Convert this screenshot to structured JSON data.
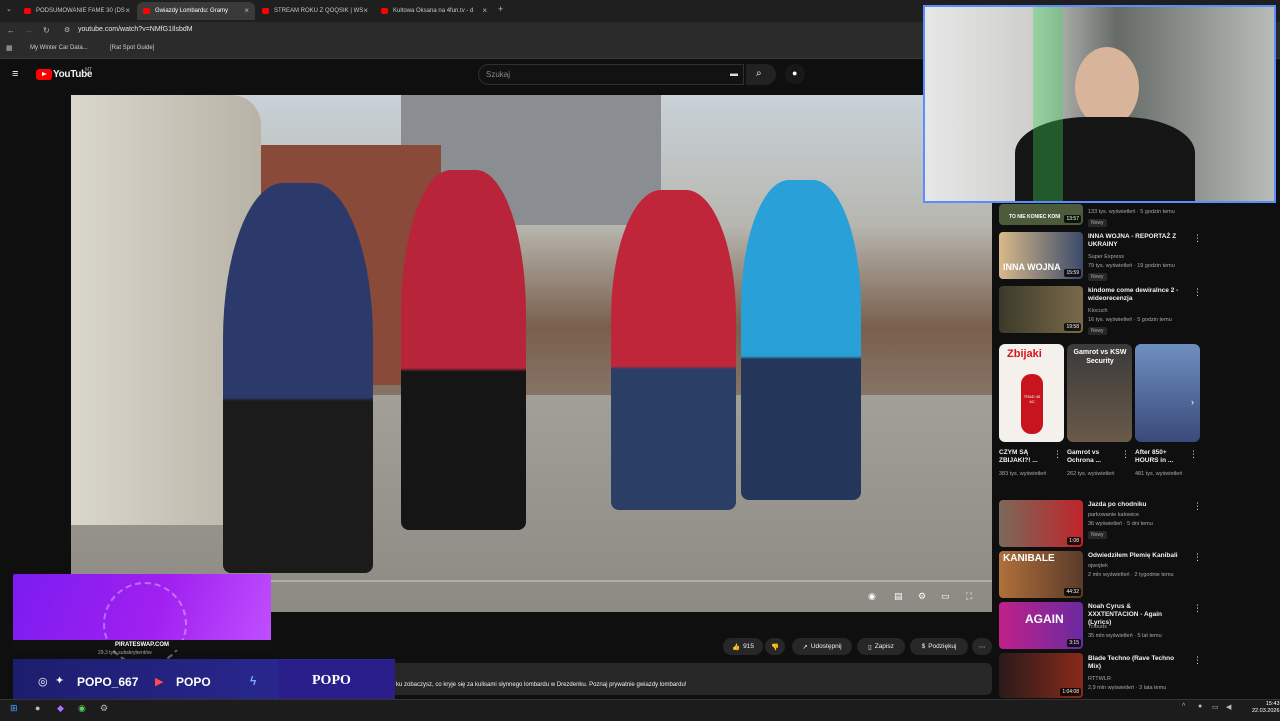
{
  "browser": {
    "tabs": [
      {
        "label": "PODSUMOWANIE FAME 30 (DS"
      },
      {
        "label": "Gwiazdy Lombardu: Gramy"
      },
      {
        "label": "STREAM ROKU Z QOQSIK | WS"
      },
      {
        "label": "Kultowa Oksana na 4fun.tv - d"
      }
    ],
    "url": "youtube.com/watch?v=NMfG1IlsbdM",
    "bookmarks": [
      "My Winter Car Data...",
      "[Rat Spot Guide]"
    ]
  },
  "youtube": {
    "logo": "YouTube",
    "country": "MT",
    "search_placeholder": "Szukaj"
  },
  "actions": {
    "likes": "915",
    "share": "Udostępnij",
    "save": "Zapisz",
    "thanks": "Podziękuj"
  },
  "channel": {
    "subscribers": "29,3 tys. subskrybentów"
  },
  "description": "ku zobaczysz, co kryje się za kulisami słynnego lombardu w Drezdenku. Poznaj prywatnie gwiazdy lombardu!",
  "recommendations": [
    {
      "title": "",
      "channel": "",
      "meta": "133 tys. wyświetleń · 5 godzin temu",
      "badge": "Nowy",
      "thumb_text": "TO NIE KONIEC KONI",
      "duration": "13:57"
    },
    {
      "title": "INNA WOJNA - REPORTAŻ Z UKRAINY",
      "channel": "Super Express",
      "meta": "79 tys. wyświetleń · 19 godzin temu",
      "badge": "Nowy",
      "thumb_text": "INNA WOJNA",
      "duration": "15:59"
    },
    {
      "title": "kindome come dewiralnce 2 - wideorecenzja",
      "channel": "Klocuch",
      "meta": "16 tys. wyświetleń · 5 godzin temu",
      "badge": "Nowy",
      "thumb_text": "",
      "duration": "19:58"
    },
    {
      "title": "Jazda po chodniku",
      "channel": "parkowanie katowice",
      "meta": "36 wyświetleń · 5 dni temu",
      "badge": "Nowy",
      "thumb_text": "",
      "duration": "1:08"
    },
    {
      "title": "Odwiedziłem Plemię Kanibali",
      "channel": "ojwojtek",
      "meta": "2 mln wyświetleń · 2 tygodnie temu",
      "badge": "",
      "thumb_text": "KANIBALE",
      "duration": "44:32"
    },
    {
      "title": "Noah Cyrus & XXXTENTACION - Again (Lyrics)",
      "channel": "7clouds",
      "meta": "35 mln wyświetleń · 5 lat temu",
      "badge": "",
      "thumb_text": "AGAIN",
      "duration": "3:15"
    },
    {
      "title": "Blade Techno (Rave Techno Mix)",
      "channel": "RTTWLR",
      "meta": "2,9 mln wyświetleń · 3 lata temu",
      "badge": "",
      "thumb_text": "",
      "duration": "1:04:08"
    }
  ],
  "shorts": [
    {
      "thumb_text": "Zbijaki",
      "thumb_sub": "TRAD 45 AC",
      "title": "CZYM SĄ ZBIJAKI?! ...",
      "views": "383 tys. wyświetleń"
    },
    {
      "thumb_text": "Gamrot vs KSW Security",
      "thumb_sub": "",
      "title": "Gamrot vs Ochrona ...",
      "views": "262 tys. wyświetleń"
    },
    {
      "thumb_text": "",
      "thumb_sub": "",
      "title": "After 850+ HOURS in ...",
      "views": "481 tys. wyświetleń"
    }
  ],
  "overlay": {
    "promo": "PIRATESWAP.COM",
    "handle1": "POPO_667",
    "handle2": "POPO",
    "brand": "POPO"
  },
  "taskbar": {
    "time": "15:43",
    "date": "22.03.2026"
  },
  "colors": {
    "yt_red": "#ff0000",
    "background": "#0f0f0f",
    "overlay_purple": "#7b1cf0",
    "webcam_border": "#5b8dff"
  }
}
